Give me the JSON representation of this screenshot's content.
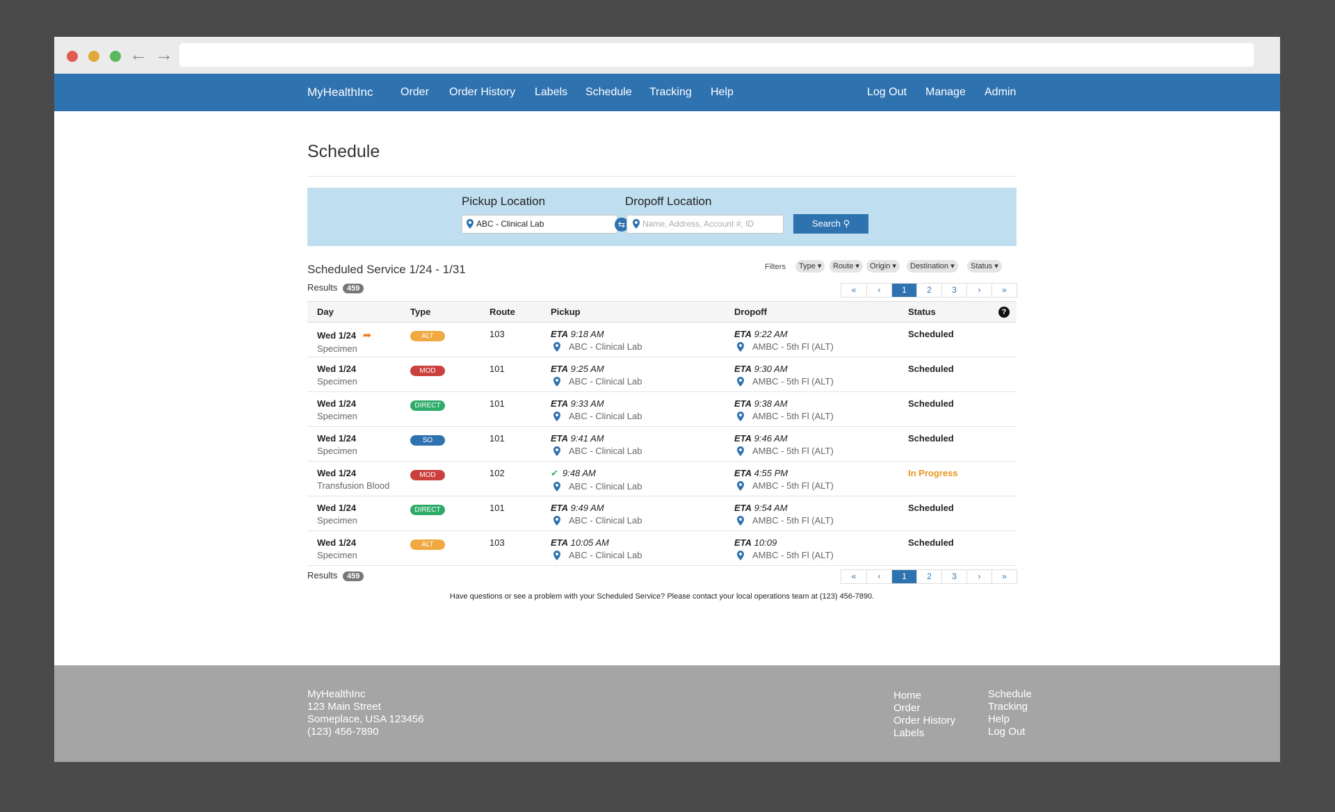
{
  "app": {
    "brand": "MyHealthInc"
  },
  "nav": {
    "order": "Order",
    "order_history": "Order History",
    "labels": "Labels",
    "schedule": "Schedule",
    "tracking": "Tracking",
    "help": "Help",
    "logout": "Log Out",
    "manage": "Manage",
    "admin": "Admin"
  },
  "page": {
    "title": "Schedule"
  },
  "search": {
    "pickup_label": "Pickup Location",
    "pickup_value": "ABC - Clinical Lab",
    "dropoff_label": "Dropoff Location",
    "dropoff_placeholder": "Name, Address, Account #, ID",
    "button": "Search"
  },
  "schedule": {
    "heading": "Scheduled Service 1/24 - 1/31",
    "filters_label": "Filters",
    "filters": [
      "Type",
      "Route",
      "Origin",
      "Destination",
      "Status"
    ],
    "results_label": "Results",
    "results_count": "459",
    "pager": [
      "«",
      "‹",
      "1",
      "2",
      "3",
      "›",
      "»"
    ],
    "columns": {
      "day": "Day",
      "type": "Type",
      "route": "Route",
      "pickup": "Pickup",
      "dropoff": "Dropoff",
      "status": "Status"
    },
    "rows": [
      {
        "day": "Wed 1/24",
        "sub": "Specimen",
        "type": "ALT",
        "route": "103",
        "pickup_eta": "9:18 AM",
        "pickup_loc": "ABC - Clinical Lab",
        "dropoff_eta": "9:22 AM",
        "dropoff_loc": "AMBC - 5th Fl (ALT)",
        "status": "Scheduled"
      },
      {
        "day": "Wed 1/24",
        "sub": "Specimen",
        "type": "MOD",
        "route": "101",
        "pickup_eta": "9:25 AM",
        "pickup_loc": "ABC - Clinical Lab",
        "dropoff_eta": "9:30 AM",
        "dropoff_loc": "AMBC - 5th Fl (ALT)",
        "status": "Scheduled"
      },
      {
        "day": "Wed 1/24",
        "sub": "Specimen",
        "type": "DIRECT",
        "route": "101",
        "pickup_eta": "9:33 AM",
        "pickup_loc": "ABC - Clinical Lab",
        "dropoff_eta": "9:38 AM",
        "dropoff_loc": "AMBC - 5th Fl (ALT)",
        "status": "Scheduled"
      },
      {
        "day": "Wed 1/24",
        "sub": "Specimen",
        "type": "SO",
        "route": "101",
        "pickup_eta": "9:41 AM",
        "pickup_loc": "ABC - Clinical Lab",
        "dropoff_eta": "9:46 AM",
        "dropoff_loc": "AMBC - 5th Fl (ALT)",
        "status": "Scheduled"
      },
      {
        "day": "Wed 1/24",
        "sub": "Transfusion Blood",
        "type": "MOD",
        "route": "102",
        "pickup_time": "9:48 AM",
        "pickup_loc": "ABC - Clinical Lab",
        "dropoff_eta": "4:55 PM",
        "dropoff_loc": "AMBC - 5th Fl (ALT)",
        "status": "In Progress"
      },
      {
        "day": "Wed 1/24",
        "sub": "Specimen",
        "type": "DIRECT",
        "route": "101",
        "pickup_eta": "9:49 AM",
        "pickup_loc": "ABC - Clinical Lab",
        "dropoff_eta": "9:54 AM",
        "dropoff_loc": "AMBC - 5th Fl (ALT)",
        "status": "Scheduled"
      },
      {
        "day": "Wed 1/24",
        "sub": "Specimen",
        "type": "ALT",
        "route": "103",
        "pickup_eta": "10:05 AM",
        "pickup_loc": "ABC - Clinical Lab",
        "dropoff_eta": "10:09",
        "dropoff_loc": "AMBC - 5th Fl (ALT)",
        "status": "Scheduled"
      }
    ],
    "eta_label": "ETA",
    "note": "Have questions or see a problem with your Scheduled Service? Please contact your local operations team at (123) 456-7890."
  },
  "footer": {
    "brand": "MyHealthInc",
    "address1": "123 Main Street",
    "address2": "Someplace, USA 123456",
    "phone": "(123) 456-7890",
    "links_col1": [
      "Home",
      "Order",
      "Order History",
      "Labels"
    ],
    "links_col2": [
      "Schedule",
      "Tracking",
      "Help",
      "Log Out"
    ]
  },
  "colors": {
    "brand_blue": "#2f72b0",
    "search_panel": "#bfdff0",
    "tag_alt": "#f0a840",
    "tag_mod": "#c9403c",
    "tag_direct": "#2eab6a",
    "tag_so": "#2f72b0",
    "status_in_progress": "#e8961e",
    "footer_bg": "#a5a5a5"
  }
}
